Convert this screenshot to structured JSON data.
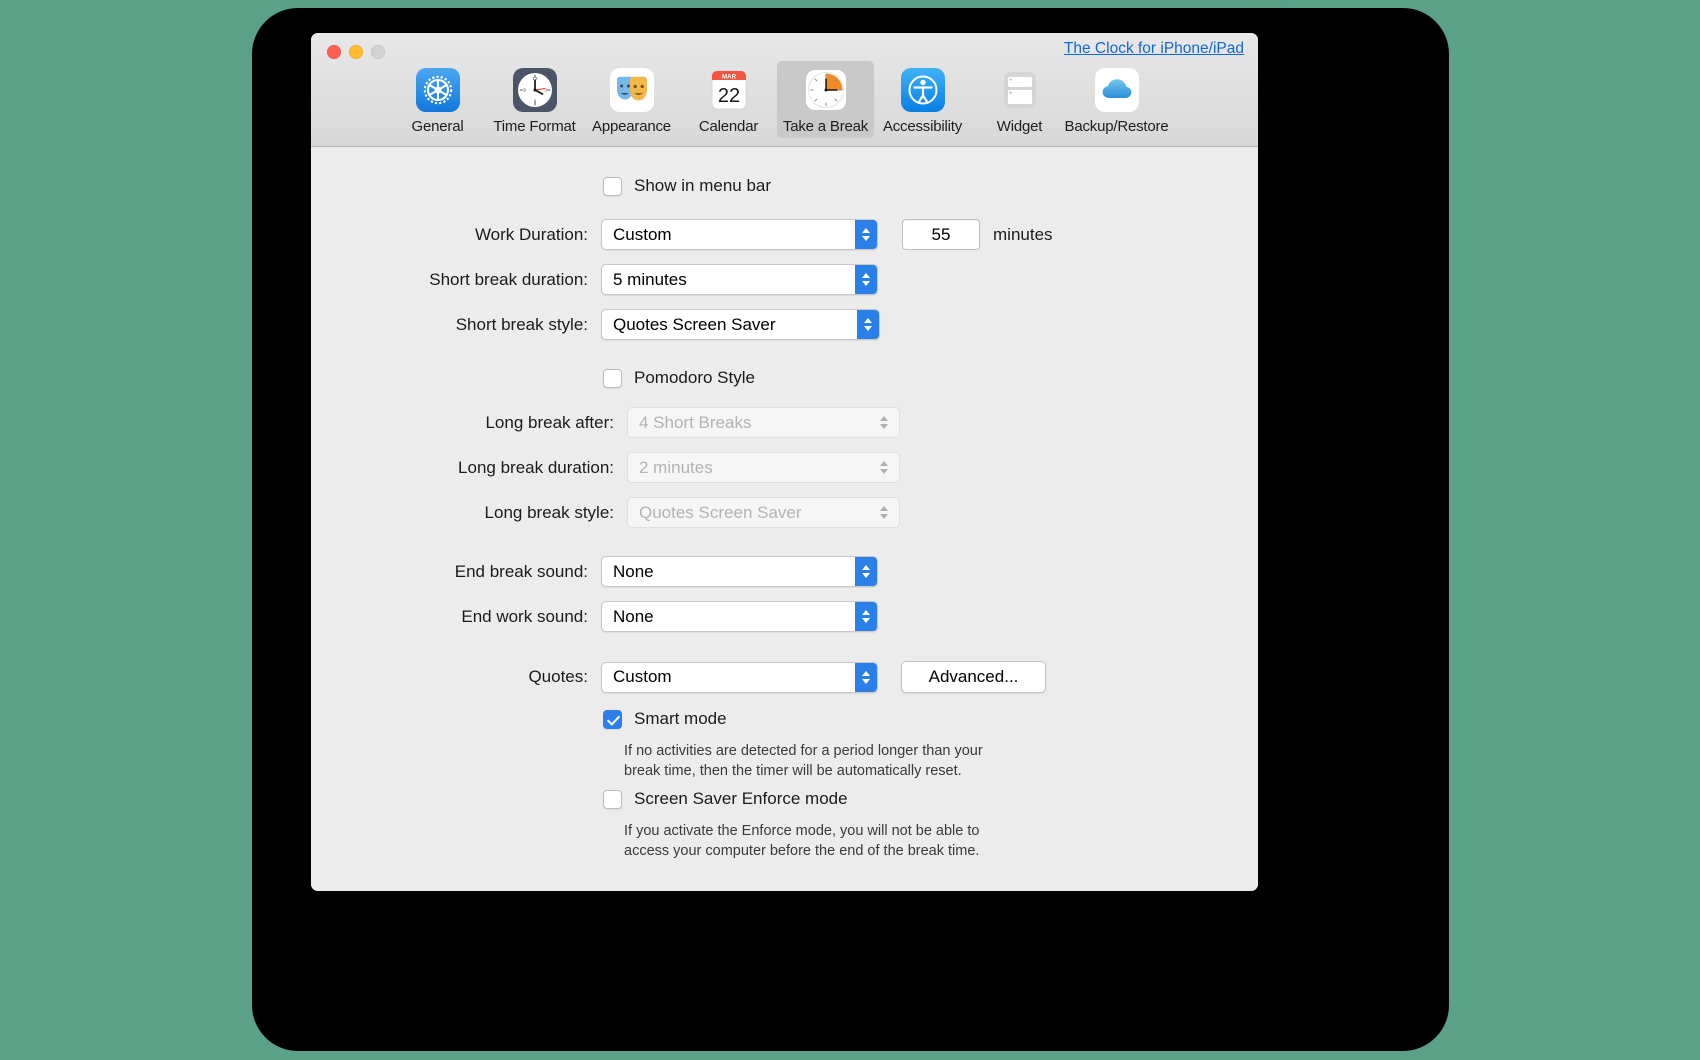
{
  "window": {
    "header_link": "The Clock for iPhone/iPad",
    "traffic_lights": [
      "close-button",
      "minimize-button",
      "zoom-button"
    ]
  },
  "toolbar": {
    "tabs": [
      {
        "label": "General",
        "icon": "gear-icon"
      },
      {
        "label": "Time Format",
        "icon": "analog-clock-icon"
      },
      {
        "label": "Appearance",
        "icon": "theater-masks-icon"
      },
      {
        "label": "Calendar",
        "icon": "calendar-icon",
        "month": "MAR",
        "day": "22"
      },
      {
        "label": "Take a Break",
        "icon": "break-timer-clock-icon",
        "selected": true
      },
      {
        "label": "Accessibility",
        "icon": "accessibility-icon"
      },
      {
        "label": "Widget",
        "icon": "widget-icon"
      },
      {
        "label": "Backup/Restore",
        "icon": "cloud-icon"
      }
    ]
  },
  "main": {
    "show_in_menu_bar": {
      "label": "Show in menu bar",
      "checked": false
    },
    "work_duration": {
      "label": "Work Duration:",
      "value": "Custom",
      "minutes_value": "55",
      "unit": "minutes"
    },
    "short_break_duration": {
      "label": "Short break duration:",
      "value": "5 minutes"
    },
    "short_break_style": {
      "label": "Short break style:",
      "value": "Quotes Screen Saver"
    },
    "pomodoro_style": {
      "label": "Pomodoro Style",
      "checked": false
    },
    "long_break_after": {
      "label": "Long break after:",
      "value": "4 Short Breaks",
      "disabled": true
    },
    "long_break_duration": {
      "label": "Long break duration:",
      "value": "2 minutes",
      "disabled": true
    },
    "long_break_style": {
      "label": "Long break style:",
      "value": "Quotes Screen Saver",
      "disabled": true
    },
    "end_break_sound": {
      "label": "End break sound:",
      "value": "None"
    },
    "end_work_sound": {
      "label": "End work sound:",
      "value": "None"
    },
    "quotes": {
      "label": "Quotes:",
      "value": "Custom",
      "advanced_button": "Advanced..."
    },
    "smart_mode": {
      "label": "Smart mode",
      "checked": true,
      "description": "If no activities are detected for a period longer than your\nbreak time, then the timer will be automatically reset."
    },
    "enforce_mode": {
      "label": "Screen Saver Enforce mode",
      "checked": false,
      "description": "If you activate the Enforce mode, you will not be able to\naccess your computer before the end of the break time."
    }
  },
  "colors": {
    "accent": "#2b7fe8",
    "link": "#1268d3",
    "window_bg": "#ececec",
    "toolbar_selected": "#c9c9c9"
  }
}
